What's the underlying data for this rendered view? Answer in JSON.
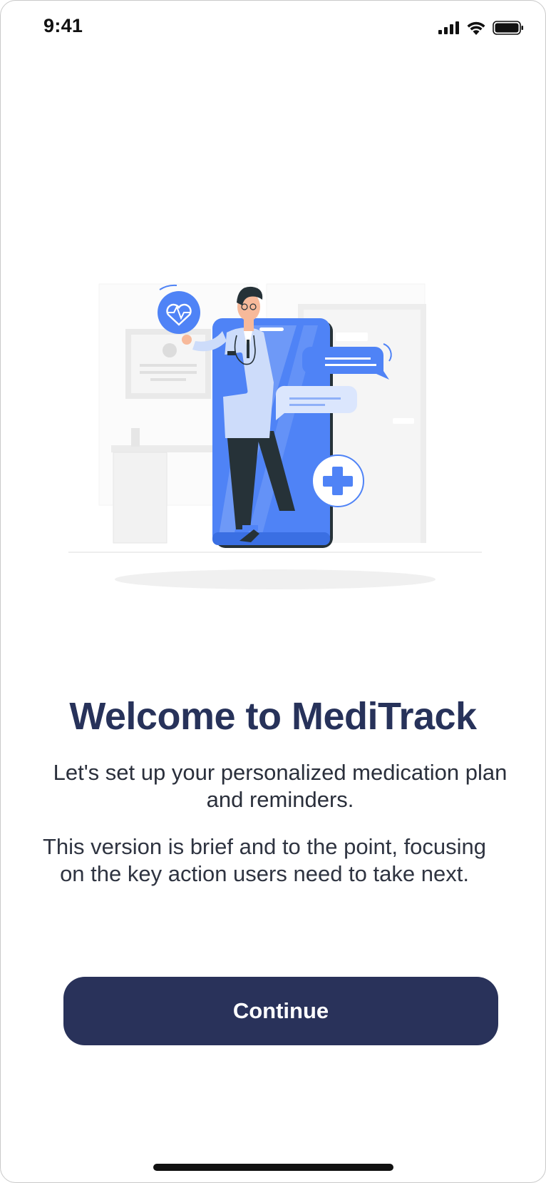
{
  "status_bar": {
    "time": "9:41"
  },
  "illustration": {
    "name": "doctor-with-phone-illustration",
    "colors": {
      "primary_blue": "#4f83f6",
      "light_blue": "#cddcfa",
      "dark": "#263238",
      "background_gray": "#f2f2f2"
    }
  },
  "welcome": {
    "title": "Welcome to MediTrack",
    "subtitle": "Let's set up your personalized medication plan and reminders.",
    "body": "This version is brief and to the point, focusing on the key action users need to take next."
  },
  "actions": {
    "continue_label": "Continue"
  },
  "colors": {
    "title": "#27325a",
    "button_background": "#29325a",
    "button_text": "#ffffff"
  }
}
